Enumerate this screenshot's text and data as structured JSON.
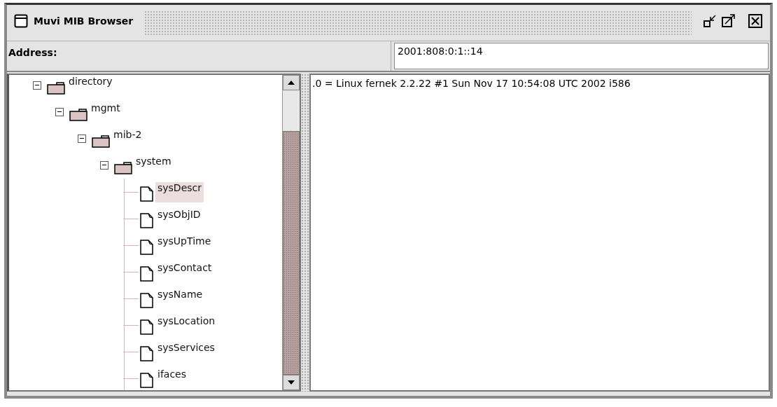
{
  "window": {
    "title": "Muvi MIB Browser"
  },
  "address": {
    "label": "Address:",
    "value": "2001:808:0:1::14"
  },
  "tree": [
    {
      "label": "directory",
      "kind": "folder",
      "expanded": true,
      "selected": false,
      "children": [
        {
          "label": "mgmt",
          "kind": "folder",
          "expanded": true,
          "selected": false,
          "children": [
            {
              "label": "mib-2",
              "kind": "folder",
              "expanded": true,
              "selected": false,
              "children": [
                {
                  "label": "system",
                  "kind": "folder",
                  "expanded": true,
                  "selected": false,
                  "children": [
                    {
                      "label": "sysDescr",
                      "kind": "leaf",
                      "selected": true
                    },
                    {
                      "label": "sysObjID",
                      "kind": "leaf",
                      "selected": false
                    },
                    {
                      "label": "sysUpTime",
                      "kind": "leaf",
                      "selected": false
                    },
                    {
                      "label": "sysContact",
                      "kind": "leaf",
                      "selected": false
                    },
                    {
                      "label": "sysName",
                      "kind": "leaf",
                      "selected": false
                    },
                    {
                      "label": "sysLocation",
                      "kind": "leaf",
                      "selected": false
                    },
                    {
                      "label": "sysServices",
                      "kind": "leaf",
                      "selected": false
                    },
                    {
                      "label": "ifaces",
                      "kind": "leaf",
                      "selected": false
                    }
                  ]
                }
              ]
            }
          ]
        }
      ]
    }
  ],
  "result": {
    "lines": [
      ".0 = Linux fernek 2.2.22 #1 Sun Nov 17 10:54:08 UTC 2002 i586"
    ]
  }
}
